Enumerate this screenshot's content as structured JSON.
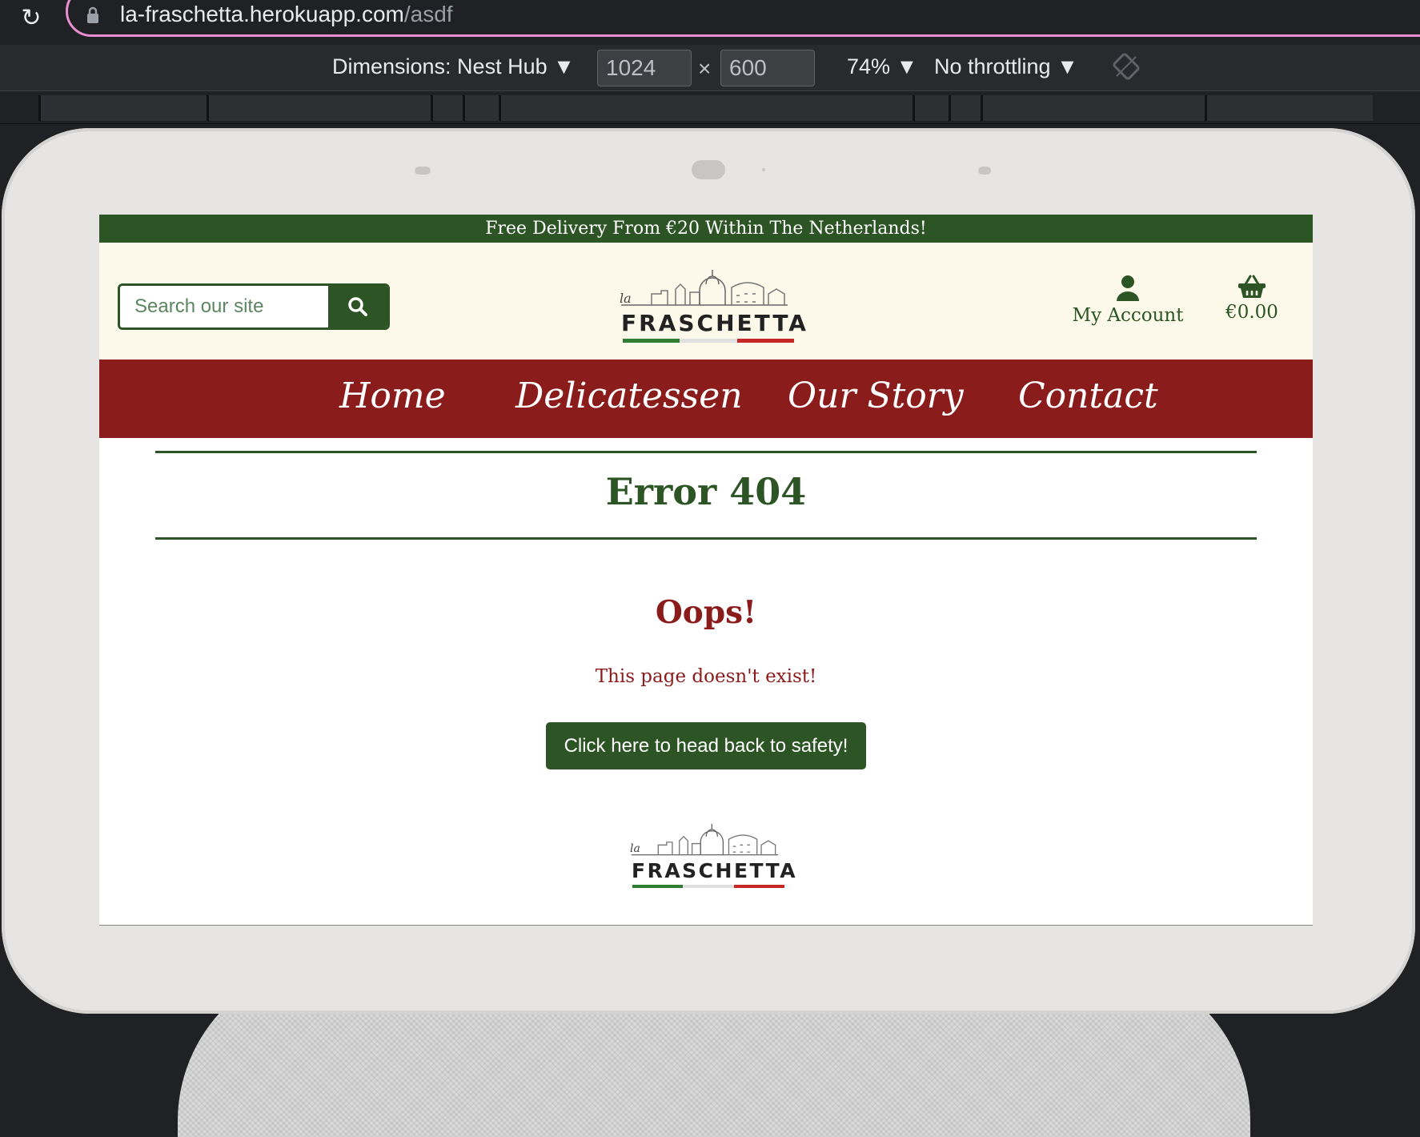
{
  "browser": {
    "url_host": "la-fraschetta.herokuapp.com",
    "url_path": "/asdf"
  },
  "devtools": {
    "dimensions_label": "Dimensions: Nest Hub ▼",
    "width_value": "1024",
    "height_value": "600",
    "separator": "×",
    "zoom_label": "74% ▼",
    "throttle_label": "No throttling ▼"
  },
  "site": {
    "banner": "Free Delivery From €20 Within The Netherlands!",
    "search": {
      "placeholder": "Search our site"
    },
    "logo": {
      "small": "la",
      "word": "FRASCHETTA"
    },
    "account_label": "My Account",
    "cart_total": "€0.00",
    "nav": [
      {
        "label": "Home"
      },
      {
        "label": "Delicatessen"
      },
      {
        "label": "Our Story"
      },
      {
        "label": "Contact"
      }
    ],
    "error_title": "Error 404",
    "oops": "Oops!",
    "message": "This page doesn't exist!",
    "back_button": "Click here to head back to safety!"
  },
  "colors": {
    "brand_green": "#2c5424",
    "brand_red": "#8b1c1c",
    "header_cream": "#fdf9ea",
    "accent_pink": "#e78fd1"
  }
}
